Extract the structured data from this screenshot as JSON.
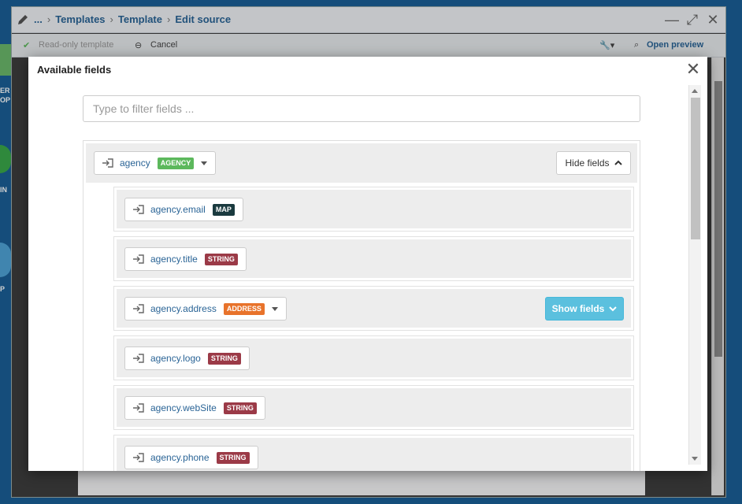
{
  "desktop": {
    "labels": [
      "ER",
      "OP",
      "IN",
      "P"
    ]
  },
  "window": {
    "breadcrumb": [
      "...",
      "Templates",
      "Template",
      "Edit source"
    ],
    "controls": {
      "minimize": "—",
      "maximize": "⤢",
      "close": "✕"
    }
  },
  "toolbar": {
    "readonly_label": "Read-only template",
    "cancel_label": "Cancel",
    "preview_label": "Open preview"
  },
  "modal": {
    "title": "Available fields",
    "close": "✕",
    "filter_placeholder": "Type to filter fields ...",
    "root": {
      "name": "agency",
      "type": "AGENCY",
      "type_color": "#5cb85c",
      "toggle_label": "Hide fields"
    },
    "fields": [
      {
        "name": "agency.email",
        "type": "MAP",
        "type_color": "#1a3a3f"
      },
      {
        "name": "agency.title",
        "type": "STRING",
        "type_color": "#9b3a47"
      },
      {
        "name": "agency.address",
        "type": "ADDRESS",
        "type_color": "#e8732b",
        "expandable": true,
        "toggle_label": "Show fields"
      },
      {
        "name": "agency.logo",
        "type": "STRING",
        "type_color": "#9b3a47"
      },
      {
        "name": "agency.webSite",
        "type": "STRING",
        "type_color": "#9b3a47"
      },
      {
        "name": "agency.phone",
        "type": "STRING",
        "type_color": "#9b3a47"
      }
    ]
  }
}
